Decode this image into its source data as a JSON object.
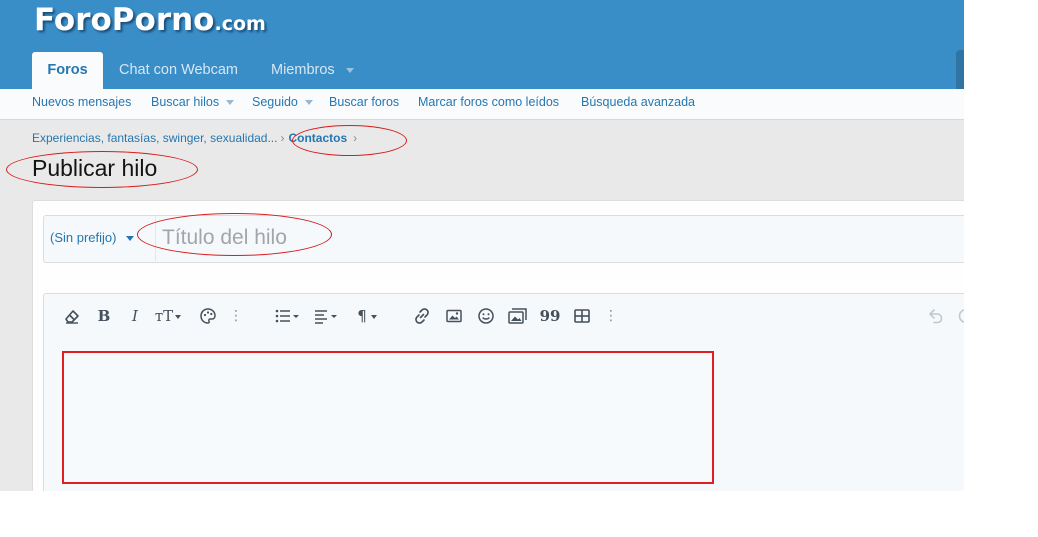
{
  "header": {
    "logo_main": "ForoPorno",
    "logo_tld": ".com",
    "nav": [
      {
        "label": "Foros",
        "active": true
      },
      {
        "label": "Chat con Webcam"
      },
      {
        "label": "Miembros",
        "has_dropdown": true
      }
    ]
  },
  "subnav": {
    "items": [
      {
        "label": "Nuevos mensajes"
      },
      {
        "label": "Buscar hilos",
        "has_dropdown": true
      },
      {
        "label": "Seguido",
        "has_dropdown": true
      },
      {
        "label": "Buscar foros"
      },
      {
        "label": "Marcar foros como leídos"
      },
      {
        "label": "Búsqueda avanzada"
      }
    ]
  },
  "breadcrumb": {
    "parent": "Experiencias, fantasías, swinger, sexualidad...",
    "current": "Contactos",
    "separator": "›"
  },
  "page_title": "Publicar hilo",
  "form": {
    "prefix": "(Sin prefijo)",
    "title_placeholder": "Título del hilo",
    "title_value": ""
  },
  "toolbar": {
    "buttons": [
      {
        "icon": "eraser-icon"
      },
      {
        "icon": "bold-icon",
        "glyph": "B"
      },
      {
        "icon": "italic-icon",
        "glyph": "I"
      },
      {
        "icon": "text-size-icon",
        "glyph": "ᴛT"
      },
      {
        "icon": "palette-icon"
      },
      {
        "icon": "more-icon"
      },
      {
        "icon": "list-icon"
      },
      {
        "icon": "align-icon"
      },
      {
        "icon": "paragraph-icon",
        "glyph": "¶"
      },
      {
        "icon": "link-icon"
      },
      {
        "icon": "image-icon"
      },
      {
        "icon": "smiley-icon"
      },
      {
        "icon": "media-icon"
      },
      {
        "icon": "quote-icon",
        "glyph": "99"
      },
      {
        "icon": "table-icon"
      },
      {
        "icon": "more-icon"
      },
      {
        "icon": "undo-icon"
      }
    ]
  },
  "colors": {
    "header_bg": "#3a8ec7",
    "link": "#2577b1",
    "annotation": "#d81b1b"
  }
}
